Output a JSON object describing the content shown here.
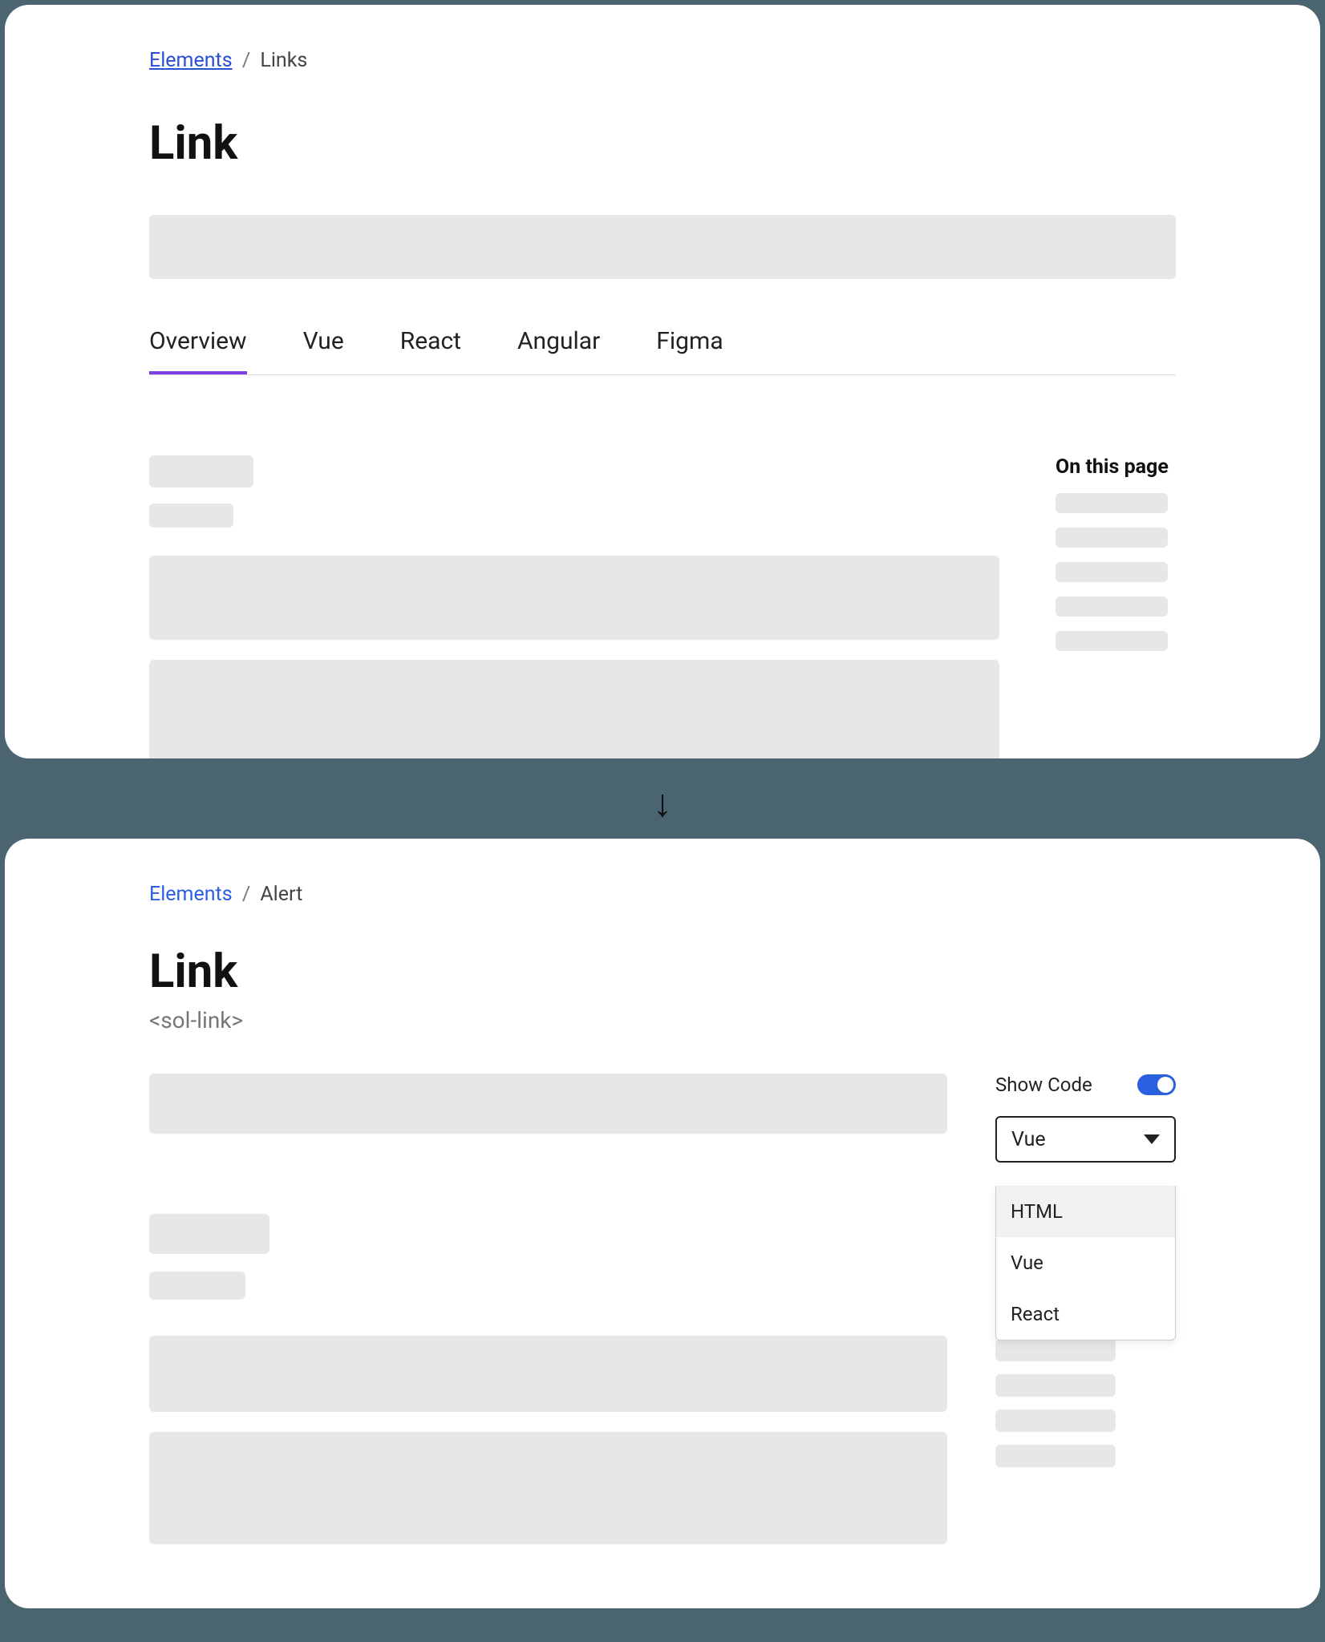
{
  "panel1": {
    "breadcrumb": {
      "parent": "Elements",
      "current": "Links"
    },
    "title": "Link",
    "tabs": [
      "Overview",
      "Vue",
      "React",
      "Angular",
      "Figma"
    ],
    "active_tab": 0,
    "side_title": "On this page"
  },
  "panel2": {
    "breadcrumb": {
      "parent": "Elements",
      "current": "Alert"
    },
    "title": "Link",
    "subtitle": "<sol-link>",
    "show_code_label": "Show Code",
    "show_code_on": true,
    "dropdown_selected": "Vue",
    "dropdown_options": [
      "HTML",
      "Vue",
      "React"
    ]
  }
}
